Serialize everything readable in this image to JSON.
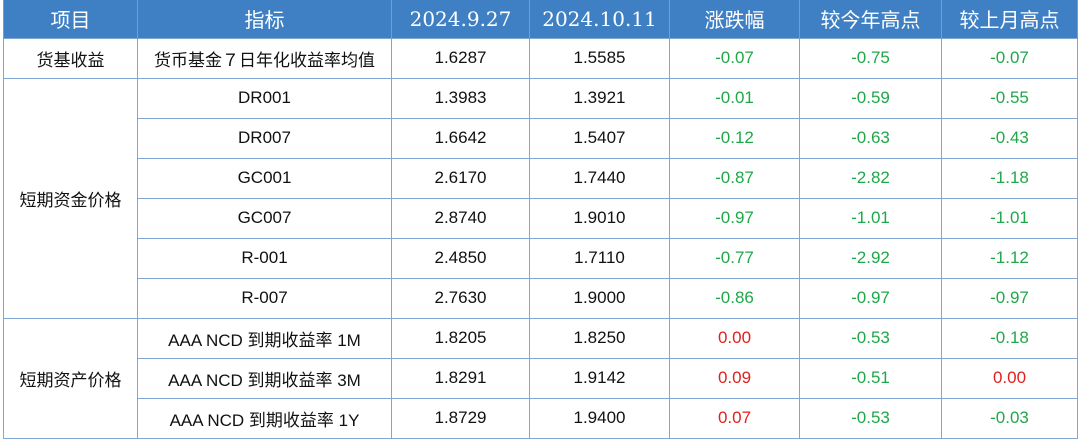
{
  "header": [
    "项目",
    "指标",
    "2024.9.27",
    "2024.10.11",
    "涨跌幅",
    "较今年高点",
    "较上月高点"
  ],
  "colors": {
    "header_bg": "#3f80c4",
    "negative": "#1fa84a",
    "non_negative": "#e0201e",
    "border": "#7fa7d4"
  },
  "groups": [
    {
      "name": "货基收益",
      "rows": [
        {
          "indicator": "货币基金７日年化收益率均值",
          "v1": "1.6287",
          "v2": "1.5585",
          "change": "-0.07",
          "vs_year_high": "-0.75",
          "vs_month_high": "-0.07"
        }
      ]
    },
    {
      "name": "短期资金价格",
      "rows": [
        {
          "indicator": "DR001",
          "v1": "1.3983",
          "v2": "1.3921",
          "change": "-0.01",
          "vs_year_high": "-0.59",
          "vs_month_high": "-0.55"
        },
        {
          "indicator": "DR007",
          "v1": "1.6642",
          "v2": "1.5407",
          "change": "-0.12",
          "vs_year_high": "-0.63",
          "vs_month_high": "-0.43"
        },
        {
          "indicator": "GC001",
          "v1": "2.6170",
          "v2": "1.7440",
          "change": "-0.87",
          "vs_year_high": "-2.82",
          "vs_month_high": "-1.18"
        },
        {
          "indicator": "GC007",
          "v1": "2.8740",
          "v2": "1.9010",
          "change": "-0.97",
          "vs_year_high": "-1.01",
          "vs_month_high": "-1.01"
        },
        {
          "indicator": "R-001",
          "v1": "2.4850",
          "v2": "1.7110",
          "change": "-0.77",
          "vs_year_high": "-2.92",
          "vs_month_high": "-1.12"
        },
        {
          "indicator": "R-007",
          "v1": "2.7630",
          "v2": "1.9000",
          "change": "-0.86",
          "vs_year_high": "-0.97",
          "vs_month_high": "-0.97"
        }
      ]
    },
    {
      "name": "短期资产价格",
      "rows": [
        {
          "indicator": "AAA NCD 到期收益率 1M",
          "v1": "1.8205",
          "v2": "1.8250",
          "change": "0.00",
          "vs_year_high": "-0.53",
          "vs_month_high": "-0.18"
        },
        {
          "indicator": "AAA NCD 到期收益率 3M",
          "v1": "1.8291",
          "v2": "1.9142",
          "change": "0.09",
          "vs_year_high": "-0.51",
          "vs_month_high": "0.00"
        },
        {
          "indicator": "AAA NCD 到期收益率 1Y",
          "v1": "1.8729",
          "v2": "1.9400",
          "change": "0.07",
          "vs_year_high": "-0.53",
          "vs_month_high": "-0.03"
        }
      ]
    }
  ]
}
